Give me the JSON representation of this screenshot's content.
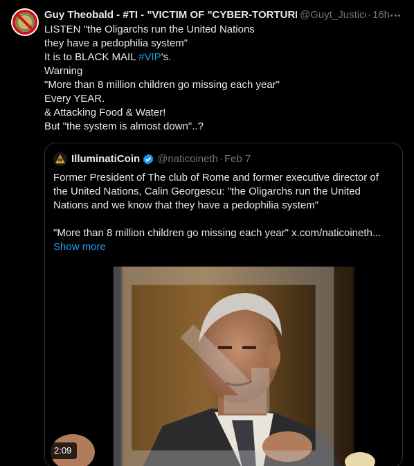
{
  "tweet": {
    "author_name": "Guy Theobald - #TI - \"VICTIM OF \"CYBER-TORTURE\"",
    "author_handle": "@Guyt_Justice",
    "separator": "·",
    "timestamp": "16h",
    "lines": [
      "LISTEN \"the Oligarchs run the United Nations",
      "they have a pedophilia system\"",
      "It is to BLACK MAIL ",
      "Warning",
      "\"More than 8 million children go missing each year\"",
      "Every YEAR.",
      "& Attacking Food & Water!",
      "But \"the system is almost down\"..?"
    ],
    "hashtag": "#VIP",
    "hashtag_suffix": "'s.",
    "accent_color": "#1d9bf0"
  },
  "quote": {
    "author_name": "IlluminatiCoin",
    "author_handle": "@naticoineth",
    "separator": "·",
    "timestamp": "Feb 7",
    "lines": [
      "Former President of The club of Rome and former executive director of",
      "the United Nations, Calin Georgescu: \"the Oligarchs run the United",
      "Nations and we know that they have a pedophilia system\"",
      "\"More than 8 million children go missing each year\"  x.com/naticoineth..."
    ],
    "show_more": "Show more",
    "video_duration": "2:09"
  },
  "icons": {
    "avatar": "no-symbol-avatar",
    "verified": "verified-badge-icon",
    "more": "more-horizontal-icon",
    "video_expand": "expand-icon"
  }
}
